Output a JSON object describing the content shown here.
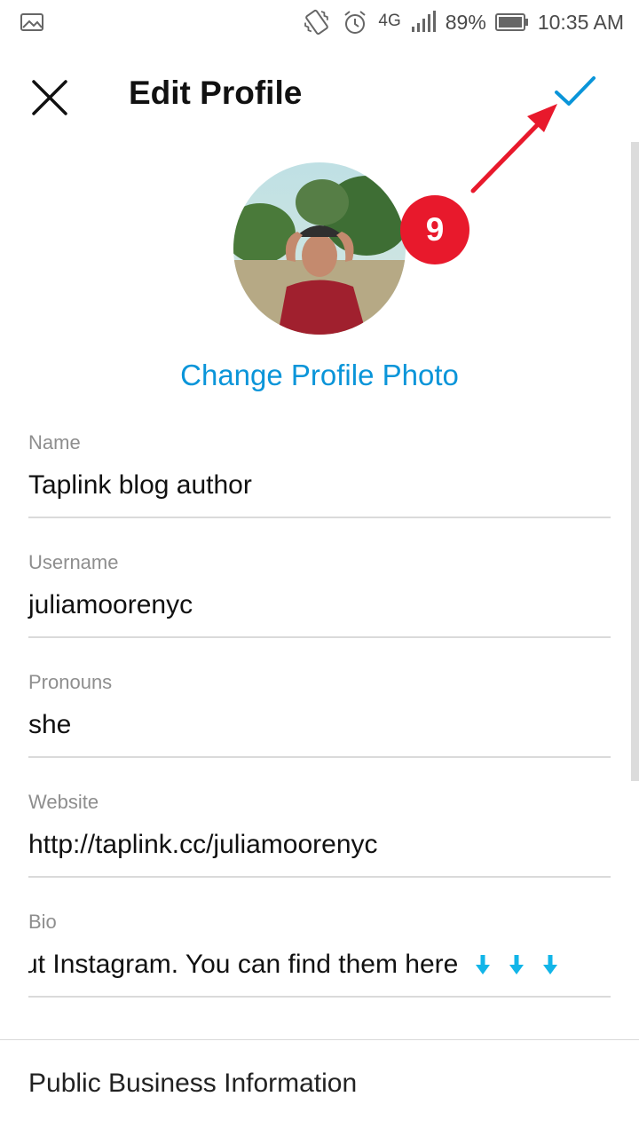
{
  "status_bar": {
    "network": "4G",
    "battery": "89%",
    "time": "10:35 AM",
    "icons": [
      "image-icon",
      "vibrate-icon",
      "alarm-icon",
      "signal-icon",
      "battery-icon"
    ]
  },
  "header": {
    "title": "Edit Profile",
    "close_icon": "close-icon",
    "done_icon": "checkmark-icon",
    "accent_color": "#0a95d9"
  },
  "profile": {
    "change_photo_label": "Change Profile Photo"
  },
  "annotation": {
    "step_number": "9",
    "color": "#e8192c"
  },
  "fields": {
    "name": {
      "label": "Name",
      "value": "Taplink blog author"
    },
    "username": {
      "label": "Username",
      "value": "juliamoorenyc"
    },
    "pronouns": {
      "label": "Pronouns",
      "value": "she"
    },
    "website": {
      "label": "Website",
      "value": "http://taplink.cc/juliamoorenyc"
    },
    "bio": {
      "label": "Bio",
      "value": "ut Instagram. You can find them here"
    }
  },
  "sections": {
    "public_business": "Public Business Information"
  }
}
